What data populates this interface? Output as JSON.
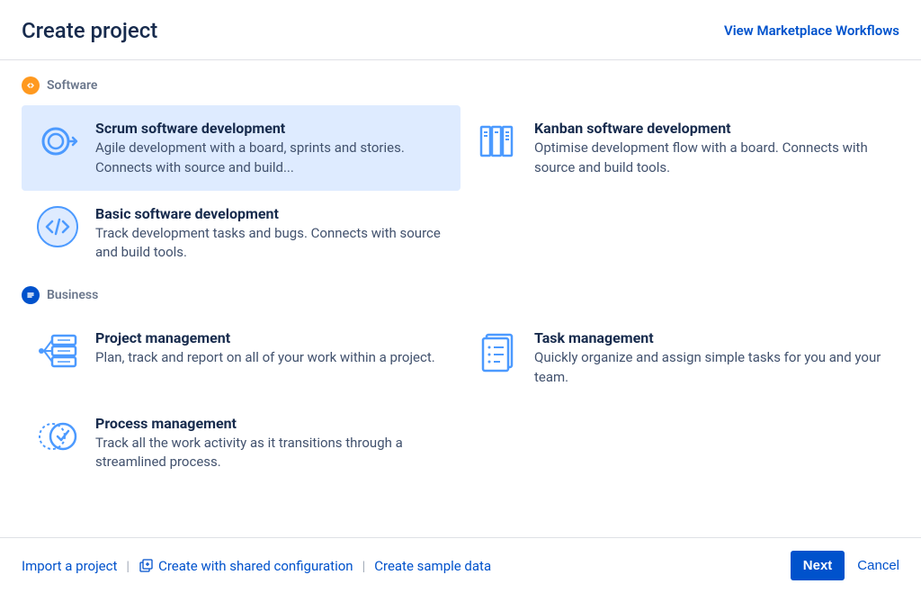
{
  "header": {
    "title": "Create project",
    "marketplace_link": "View Marketplace Workflows"
  },
  "categories": {
    "software": {
      "label": "Software",
      "templates": {
        "scrum": {
          "title": "Scrum software development",
          "desc": "Agile development with a board, sprints and stories. Connects with source and build..."
        },
        "kanban": {
          "title": "Kanban software development",
          "desc": "Optimise development flow with a board. Connects with source and build tools."
        },
        "basic": {
          "title": "Basic software development",
          "desc": "Track development tasks and bugs. Connects with source and build tools."
        }
      }
    },
    "business": {
      "label": "Business",
      "templates": {
        "project_mgmt": {
          "title": "Project management",
          "desc": "Plan, track and report on all of your work within a project."
        },
        "task_mgmt": {
          "title": "Task management",
          "desc": "Quickly organize and assign simple tasks for you and your team."
        },
        "process_mgmt": {
          "title": "Process management",
          "desc": "Track all the work activity as it transitions through a streamlined process."
        }
      }
    }
  },
  "footer": {
    "import_link": "Import a project",
    "shared_config_link": "Create with shared configuration",
    "sample_data_link": "Create sample data",
    "next_label": "Next",
    "cancel_label": "Cancel"
  }
}
